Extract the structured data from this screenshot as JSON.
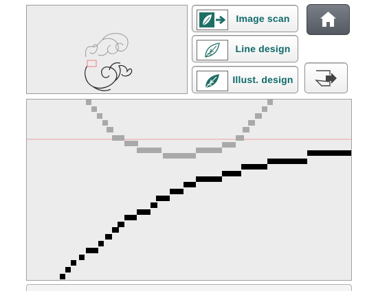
{
  "buttons": {
    "image_scan": {
      "label": "Image scan",
      "icon": "leaf-scan-arrow-icon"
    },
    "line_design": {
      "label": "Line design",
      "icon": "leaf-outline-icon"
    },
    "illust_design": {
      "label": "Illust. design",
      "icon": "leaf-filled-icon"
    },
    "home": {
      "icon": "home-icon"
    },
    "exit": {
      "icon": "exit-arrow-icon"
    }
  },
  "colors": {
    "label_text": "#0f6a6a",
    "icon_teal": "#1f6e66",
    "guide_line": "#f0a0a0",
    "gray_curve": "#a9a9a9",
    "black_curve": "#000000",
    "preview_frame": "#f08080"
  }
}
